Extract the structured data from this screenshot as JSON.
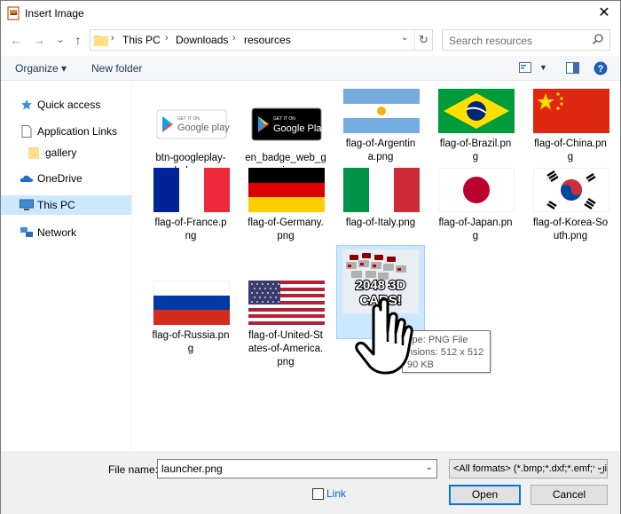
{
  "window": {
    "title": "Insert Image",
    "close_glyph": "✕"
  },
  "nav": {
    "back_glyph": "←",
    "forward_glyph": "→",
    "recent_glyph": "⌄",
    "up_glyph": "↑",
    "breadcrumbs": [
      "This PC",
      "Downloads",
      "resources"
    ],
    "separator": "›",
    "dropdown_glyph": "⌄",
    "refresh_glyph": "↻"
  },
  "search": {
    "placeholder": "Search resources"
  },
  "toolbar": {
    "organize_label": "Organize ▾",
    "new_folder_label": "New folder"
  },
  "sidebar": {
    "items": [
      {
        "label": "Quick access",
        "icon": "star-icon"
      },
      {
        "label": "Application Links",
        "icon": "document-icon"
      },
      {
        "label": "gallery",
        "icon": "folder-icon"
      },
      {
        "label": "OneDrive",
        "icon": "cloud-icon"
      },
      {
        "label": "This PC",
        "icon": "computer-icon",
        "selected": true
      },
      {
        "label": "Network",
        "icon": "network-icon"
      }
    ]
  },
  "files": [
    {
      "name": "btn-googleplay-dark.png",
      "caption": [
        "btn-googleplay-",
        "dark.png"
      ],
      "art": "googleplay-light"
    },
    {
      "name": "en_badge_web_generic.png",
      "caption": [
        "en_badge_web_g",
        "eneric.png"
      ],
      "art": "googleplay-dark"
    },
    {
      "name": "flag-of-Argentina.png",
      "caption": [
        "flag-of-Argentin",
        "a.png"
      ],
      "art": "argentina"
    },
    {
      "name": "flag-of-Brazil.png",
      "caption": [
        "flag-of-Brazil.pn",
        "g"
      ],
      "art": "brazil"
    },
    {
      "name": "flag-of-China.png",
      "caption": [
        "flag-of-China.pn",
        "g"
      ],
      "art": "china"
    },
    {
      "name": "flag-of-France.png",
      "caption": [
        "flag-of-France.p",
        "ng"
      ],
      "art": "france"
    },
    {
      "name": "flag-of-Germany.png",
      "caption": [
        "flag-of-Germany.",
        "png"
      ],
      "art": "germany"
    },
    {
      "name": "flag-of-Italy.png",
      "caption": [
        "flag-of-Italy.png"
      ],
      "art": "italy"
    },
    {
      "name": "flag-of-Japan.png",
      "caption": [
        "flag-of-Japan.pn",
        "g"
      ],
      "art": "japan"
    },
    {
      "name": "flag-of-Korea-South.png",
      "caption": [
        "flag-of-Korea-So",
        "uth.png"
      ],
      "art": "korea"
    },
    {
      "name": "flag-of-Russia.png",
      "caption": [
        "flag-of-Russia.pn",
        "g"
      ],
      "art": "russia"
    },
    {
      "name": "flag-of-United-States-of-America.png",
      "caption": [
        "flag-of-United-St",
        "ates-of-America.",
        "png"
      ],
      "art": "usa"
    },
    {
      "name": "launcher.png",
      "caption": [
        "laun"
      ],
      "art": "launcher",
      "selected": true
    }
  ],
  "launcher_art": {
    "text_line1": "2048 3D",
    "text_line2": "CARS!"
  },
  "badges": {
    "google_play_small": "GET IT ON",
    "google_play_big": "Google play",
    "google_play_big_dark": "Google Play"
  },
  "tooltip": {
    "line1": "ype: PNG File",
    "line2": "nsions: 512 x 512",
    "line3": "90 KB"
  },
  "footer": {
    "file_name_label": "File name:",
    "file_name_value": "launcher.png",
    "format_value": "<All formats> (*.bmp;*.dxf;*.emf;*.gif;*.jpg)",
    "link_label": "Link",
    "open_label": "Open",
    "cancel_label": "Cancel"
  },
  "colors": {
    "selection_bg": "#cce8ff",
    "selection_border": "#99d1ff",
    "accent": "#0078d7",
    "toolbar_text": "#1e395b"
  }
}
